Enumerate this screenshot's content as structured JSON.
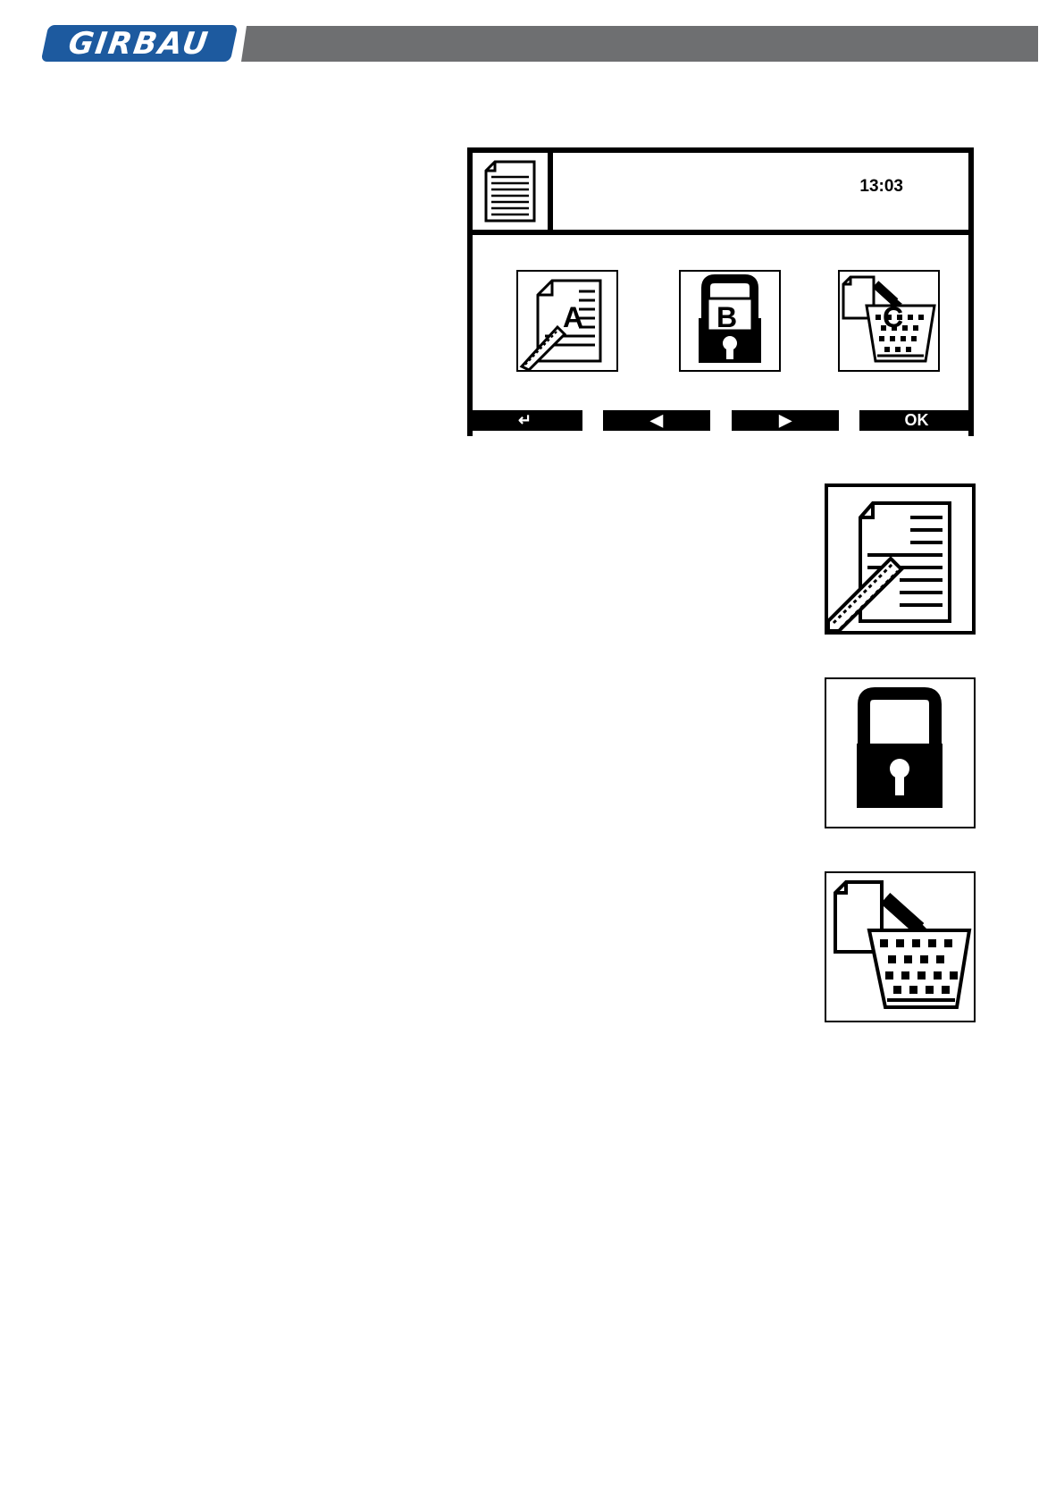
{
  "brand": {
    "logo_text": "GIRBAU",
    "bar_color": "#6e6f71",
    "logo_color": "#1d5a9f"
  },
  "screen": {
    "status_icon": "document-icon",
    "time": "13:03",
    "menu": [
      {
        "letter": "A",
        "icon": "edit-document-icon"
      },
      {
        "letter": "B",
        "icon": "lock-icon"
      },
      {
        "letter": "C",
        "icon": "delete-to-basket-icon"
      }
    ],
    "softkeys": {
      "back": "↵",
      "prev": "◀",
      "next": "▶",
      "ok": "OK"
    }
  },
  "legend_icons": [
    "edit-document-icon",
    "lock-icon",
    "delete-to-basket-icon"
  ]
}
